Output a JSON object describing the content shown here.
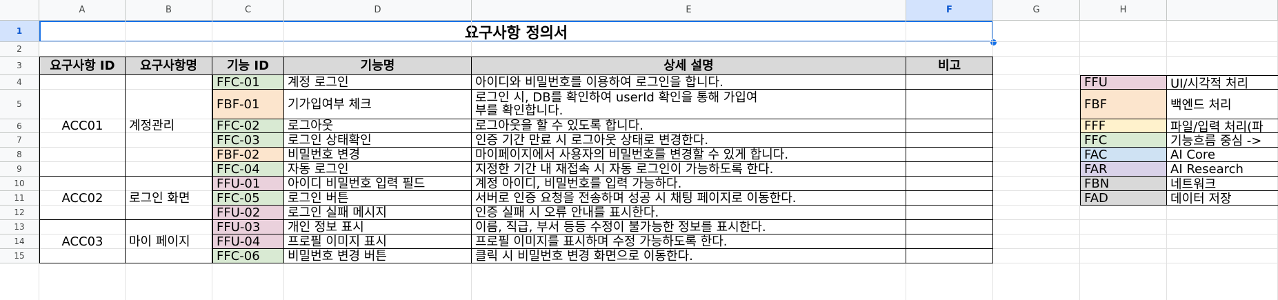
{
  "columns": [
    "A",
    "B",
    "C",
    "D",
    "E",
    "F",
    "G",
    "H"
  ],
  "rows": [
    "1",
    "2",
    "3",
    "4",
    "5",
    "6",
    "7",
    "8",
    "9",
    "10",
    "11",
    "12",
    "13",
    "14",
    "15"
  ],
  "selected_column": "F",
  "selected_row": "1",
  "title": "요구사항 정의서",
  "headers": [
    "요구사항 ID",
    "요구사항명",
    "기능 ID",
    "기능명",
    "상세 설명",
    "비고"
  ],
  "groups": [
    {
      "id": "ACC01",
      "name": "계정관리"
    },
    {
      "id": "ACC02",
      "name": "로그인 화면"
    },
    {
      "id": "ACC03",
      "name": "마이 페이지"
    }
  ],
  "features": [
    {
      "code": "FFC-01",
      "name": "계정 로그인",
      "desc": "아이디와 비밀번호를 이용하여 로그인을 합니다.",
      "cat": "g"
    },
    {
      "code": "FBF-01",
      "name": "기가입여부 체크",
      "desc": "로그인 시, DB를 확인하여 userId 확인을 통해 가입여부를 확인합니다.",
      "cat": "o"
    },
    {
      "code": "FFC-02",
      "name": "로그아웃",
      "desc": "로그아웃을 할 수 있도록 합니다.",
      "cat": "g"
    },
    {
      "code": "FFC-03",
      "name": "로그인 상태확인",
      "desc": "인증 기간 만료 시 로그아웃 상태로 변경한다.",
      "cat": "g"
    },
    {
      "code": "FBF-02",
      "name": "비밀번호 변경",
      "desc": "마이페이지에서 사용자의 비밀번호를 변경할 수 있게 합니다.",
      "cat": "o"
    },
    {
      "code": "FFC-04",
      "name": "자동 로그인",
      "desc": "지정한 기간 내 재접속 시 자동 로그인이 가능하도록 한다.",
      "cat": "g"
    },
    {
      "code": "FFU-01",
      "name": "아이디 비밀번호 입력 필드",
      "desc": "계정 아이디, 비밀번호를 입력 가능하다.",
      "cat": "p"
    },
    {
      "code": "FFC-05",
      "name": "로그인 버튼",
      "desc": "서버로 인증 요청을 전송하며 성공 시 채팅 페이지로 이동한다.",
      "cat": "g"
    },
    {
      "code": "FFU-02",
      "name": "로그인 실패 메시지",
      "desc": "인증 실패 시 오류 안내를 표시한다.",
      "cat": "p"
    },
    {
      "code": "FFU-03",
      "name": "개인 정보 표시",
      "desc": "이름, 직급, 부서 등등 수정이 불가능한 정보를 표시한다.",
      "cat": "p"
    },
    {
      "code": "FFU-04",
      "name": "프로필 이미지 표시",
      "desc": "프로필 이미지를 표시하며 수정 가능하도록 한다.",
      "cat": "p"
    },
    {
      "code": "FFC-06",
      "name": "비밀번호 변경 버튼",
      "desc": "클릭 시 비밀번호 변경 화면으로 이동한다.",
      "cat": "g"
    }
  ],
  "legend": [
    {
      "code": "FFU",
      "label": "UI/시각적 처리",
      "cat": "p"
    },
    {
      "code": "FBF",
      "label": "백엔드 처리",
      "cat": "o"
    },
    {
      "code": "FFF",
      "label": "파일/입력 처리(파",
      "cat": "y"
    },
    {
      "code": "FFC",
      "label": "기능흐름 중심 ->",
      "cat": "g"
    },
    {
      "code": "FAC",
      "label": "AI Core",
      "cat": "bl"
    },
    {
      "code": "FAR",
      "label": "AI Research",
      "cat": "pu"
    },
    {
      "code": "FBN",
      "label": "네트워크",
      "cat": "gr"
    },
    {
      "code": "FAD",
      "label": "데이터 저장",
      "cat": "gr"
    }
  ]
}
